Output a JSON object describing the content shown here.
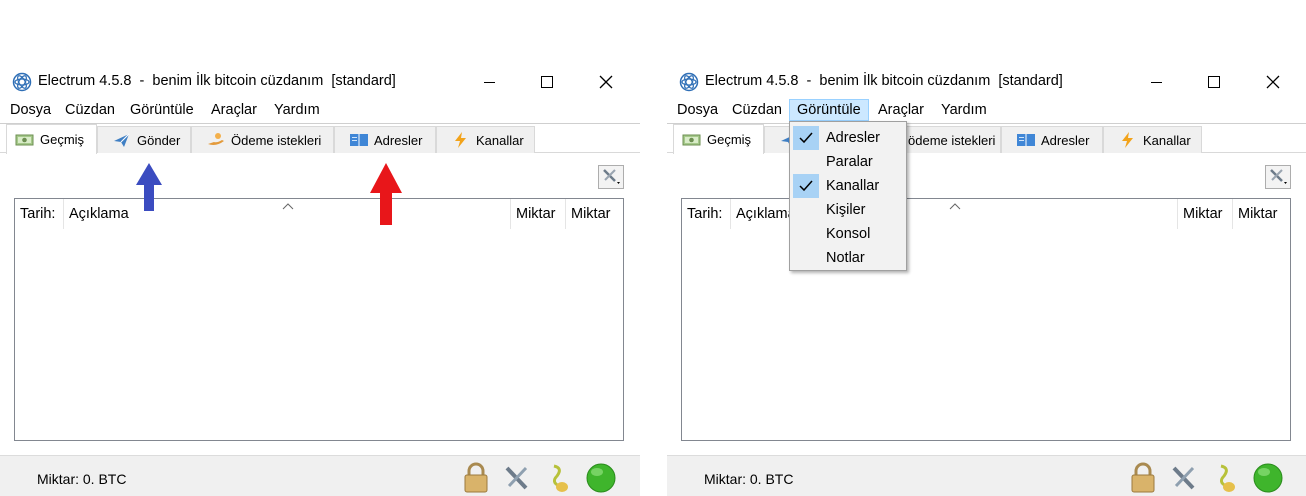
{
  "windows": [
    {
      "id": "left",
      "title": "Electrum 4.5.8  -  benim İlk bitcoin cüzdanım  [standard]",
      "menu": [
        "Dosya",
        "Cüzdan",
        "Görüntüle",
        "Araçlar",
        "Yardım"
      ],
      "tabs": [
        "Geçmiş",
        "Gönder",
        "Ödeme istekleri",
        "Adresler",
        "Kanallar"
      ],
      "columns": [
        "Tarih:",
        "Açıklama",
        "Miktar",
        "Miktar"
      ],
      "status": "Miktar: 0. BTC"
    },
    {
      "id": "right",
      "title": "Electrum 4.5.8  -  benim İlk bitcoin cüzdanım  [standard]",
      "menu": [
        "Dosya",
        "Cüzdan",
        "Görüntüle",
        "Araçlar",
        "Yardım"
      ],
      "tabs": [
        "Geçmiş",
        "",
        "ödeme istekleri",
        "Adresler",
        "Kanallar"
      ],
      "columns": [
        "Tarih:",
        "Açıklama",
        "Miktar",
        "Miktar"
      ],
      "status": "Miktar: 0. BTC",
      "view_menu": {
        "items": [
          {
            "label": "Adresler",
            "checked": true
          },
          {
            "label": "Paralar",
            "checked": false
          },
          {
            "label": "Kanallar",
            "checked": true
          },
          {
            "label": "Kişiler",
            "checked": false
          },
          {
            "label": "Konsol",
            "checked": false
          },
          {
            "label": "Notlar",
            "checked": false
          }
        ]
      }
    }
  ],
  "annotations": {
    "blue_arrow_color": "#3b4cc0",
    "red_arrow_color": "#e8161a"
  },
  "icons": {
    "status_bar": [
      "lock-icon",
      "tools-icon",
      "seed-icon",
      "network-status-icon"
    ],
    "tabs": [
      "history-icon",
      "send-icon",
      "receive-icon",
      "addresses-icon",
      "channels-icon"
    ]
  }
}
